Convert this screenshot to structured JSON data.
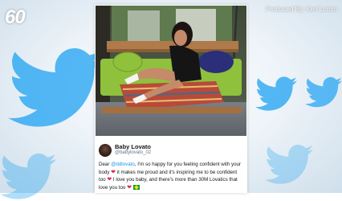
{
  "brand": {
    "logo_text": "60",
    "credit": "Produced By: Keri Lumm"
  },
  "tweet": {
    "display_name": "Baby Lovato",
    "handle": "@babylovato_02",
    "line1_prefix": "Dear ",
    "mention": "@ddlovato",
    "line1_suffix": ", I'm so happy for you feeling confident with your",
    "line2_a": "body ",
    "line2_b": " it makes me proud and it's inspiring me to be confident",
    "line3_a": "too ",
    "line3_b": " I love you baby, and there's more than 30M Lovatics that",
    "line4_a": "love you too ",
    "heart_glyph": "❤"
  },
  "colors": {
    "twitter_blue": "#1da1f2",
    "heart": "#e0245e",
    "mention": "#1b95e0"
  },
  "icons": [
    "twitter-bird-icon",
    "heart-icon",
    "brazil-flag-icon"
  ]
}
